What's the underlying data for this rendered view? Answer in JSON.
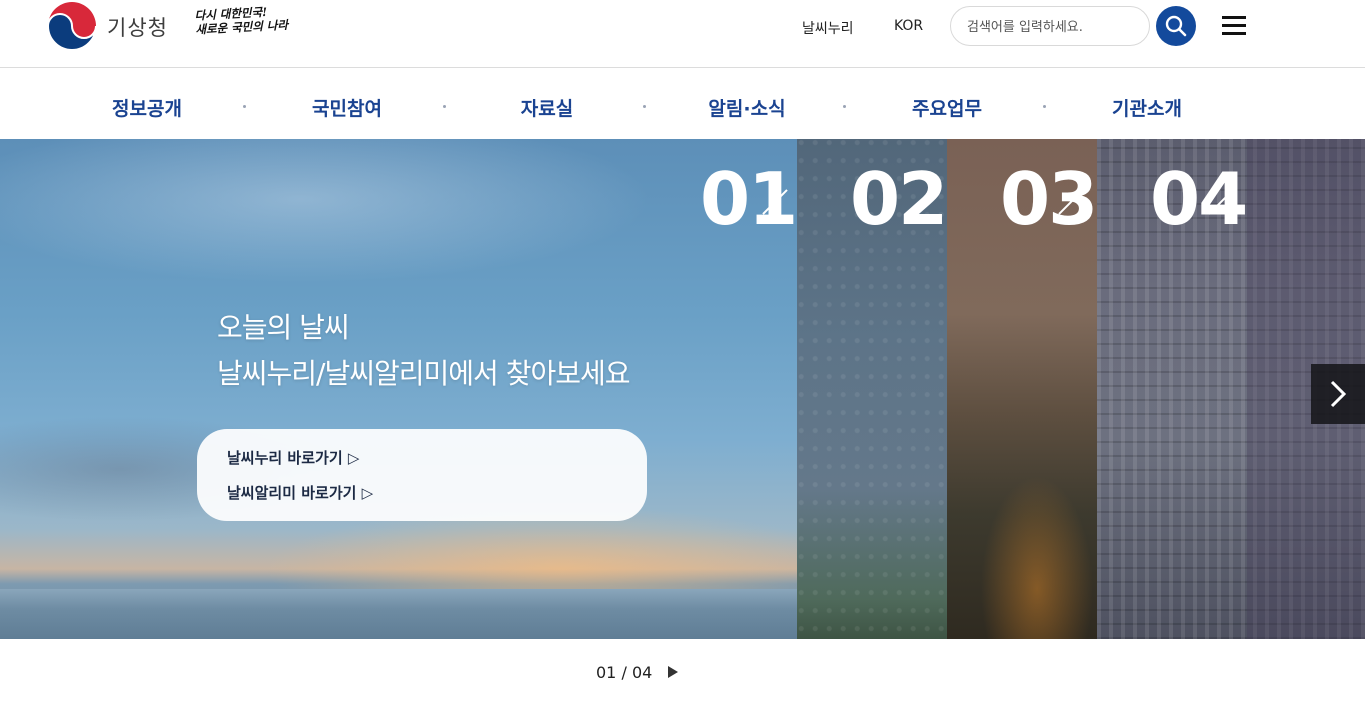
{
  "header": {
    "logo_name": "기상청",
    "slogan_line1": "다시 대한민국!",
    "slogan_line2": "새로운 국민의 나라",
    "util_links": [
      "날씨누리",
      "KOR"
    ],
    "search": {
      "placeholder": "검색어를 입력하세요.",
      "value": "",
      "icon": "search-icon"
    },
    "menu_icon": "hamburger-icon",
    "accent_color": "#134a9c"
  },
  "gnb": {
    "items": [
      "정보공개",
      "국민참여",
      "자료실",
      "알림·소식",
      "주요업무",
      "기관소개"
    ],
    "color": "#1a4391"
  },
  "visual": {
    "title_line1": "오늘의 날씨",
    "title_line2": "날씨누리/날씨알리미에서 찾아보세요",
    "links": [
      "날씨누리 바로가기 ▷",
      "날씨알리미 바로가기 ▷"
    ],
    "panels": [
      "01",
      "02",
      "03",
      "04"
    ],
    "next_icon": "chevron-right-icon"
  },
  "pager": {
    "current": "01",
    "separator": "/",
    "total": "04",
    "play_icon": "play-icon"
  }
}
